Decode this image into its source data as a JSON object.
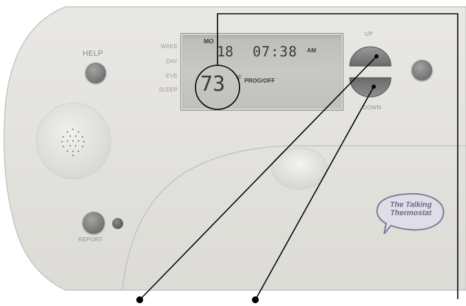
{
  "device": {
    "left_panel": {
      "help_label": "HELP",
      "report_label": "REPORT"
    },
    "modes": [
      "WAKE",
      "DAY",
      "EVE",
      "SLEEP"
    ],
    "display": {
      "day": "MO",
      "date": "18",
      "time": "07:38",
      "meridiem": "AM",
      "temperature": "73",
      "unit": "°F",
      "program_status": "PROG/OFF"
    },
    "controls": {
      "up_label": "UP",
      "down_label": "DOWN"
    },
    "brand_logo": {
      "line1": "The Talking",
      "line2": "Thermostat"
    }
  },
  "colors": {
    "body": "#e3e2dd",
    "lcd_background": "#c4c3be",
    "button": "#7a7a7a",
    "callout_line": "#000000"
  }
}
